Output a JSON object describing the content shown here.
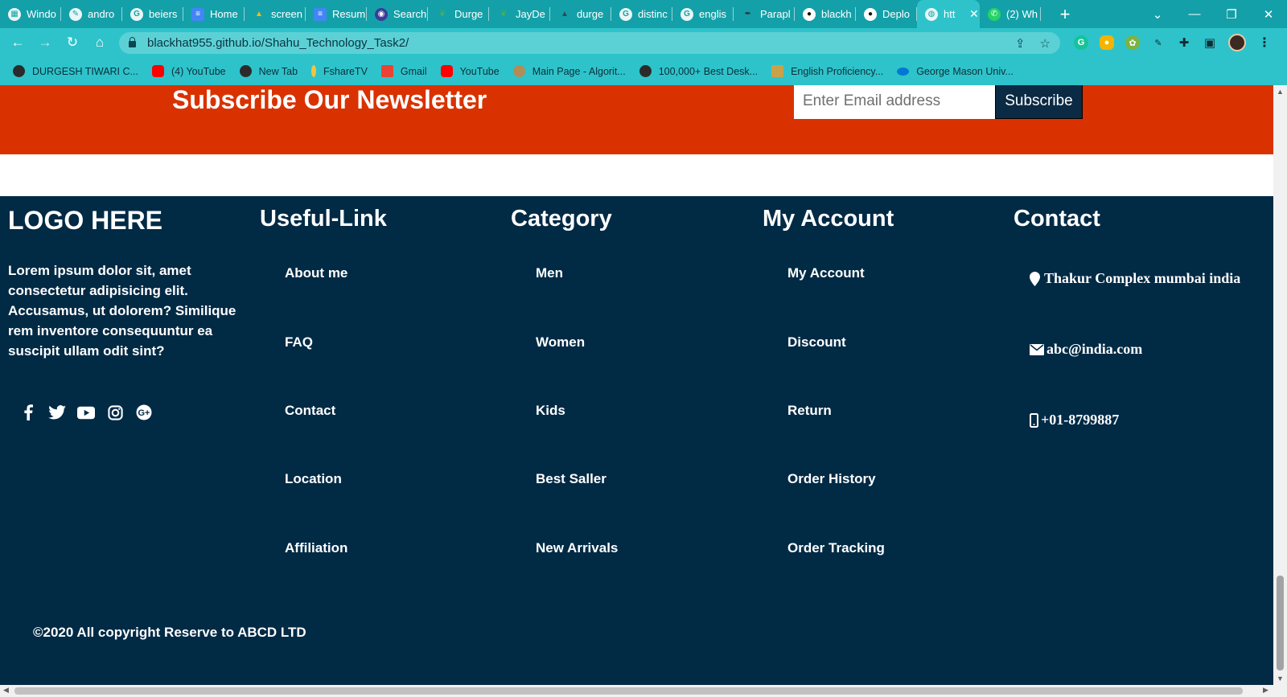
{
  "browser": {
    "tabs": [
      {
        "label": "Windo",
        "icon": "ms-icon",
        "color": "#1e88e5"
      },
      {
        "label": "andro",
        "icon": "android-icon",
        "color": "#a56b2a"
      },
      {
        "label": "beiers",
        "icon": "google-icon",
        "color": "#ffffff"
      },
      {
        "label": "Home",
        "icon": "docs-icon",
        "color": "#4285f4"
      },
      {
        "label": "screen",
        "icon": "drive-icon",
        "color": "#fbbc04"
      },
      {
        "label": "Resum",
        "icon": "docs-icon",
        "color": "#4285f4"
      },
      {
        "label": "Search",
        "icon": "search-engine-icon",
        "color": "#3b3b9b"
      },
      {
        "label": "Durge",
        "icon": "leaf-icon",
        "color": "#4caf50"
      },
      {
        "label": "JayDe",
        "icon": "leaf-icon",
        "color": "#4caf50"
      },
      {
        "label": "durge",
        "icon": "tent-icon",
        "color": "#37474f"
      },
      {
        "label": "distinc",
        "icon": "google-icon",
        "color": "#ffffff"
      },
      {
        "label": "englis",
        "icon": "google-icon",
        "color": "#ffffff"
      },
      {
        "label": "Parapl",
        "icon": "feather-icon",
        "color": "#455a64"
      },
      {
        "label": "blackh",
        "icon": "github-icon",
        "color": "#ffffff"
      },
      {
        "label": "Deplo",
        "icon": "github-icon",
        "color": "#ffffff"
      },
      {
        "label": "htt",
        "icon": "globe-icon",
        "color": "#ffffff",
        "active": true
      },
      {
        "label": "(2) Wh",
        "icon": "whatsapp-icon",
        "color": "#25d366"
      }
    ],
    "new_tab": "+",
    "url": "blackhat955.github.io/Shahu_Technology_Task2/",
    "bookmarks": [
      {
        "label": "DURGESH TIWARI C...",
        "color": "#2b2b2b"
      },
      {
        "label": "(4) YouTube",
        "color": "#ff0000"
      },
      {
        "label": "New Tab",
        "color": "#2b2b2b"
      },
      {
        "label": "FshareTV",
        "color": "#f5c242"
      },
      {
        "label": "Gmail",
        "color": "#ea4335"
      },
      {
        "label": "YouTube",
        "color": "#ff0000"
      },
      {
        "label": "Main Page - Algorit...",
        "color": "#b08d57"
      },
      {
        "label": "100,000+ Best Desk...",
        "color": "#2b2b2b"
      },
      {
        "label": "English Proficiency...",
        "color": "#c8a24b"
      },
      {
        "label": "George Mason Univ...",
        "color": "#0078d4"
      }
    ]
  },
  "newsletter": {
    "title": "Subscribe Our Newsletter",
    "email_placeholder": "Enter Email address",
    "subscribe_label": "Subscribe",
    "bg_color": "#d93200"
  },
  "footer": {
    "logo": "LOGO HERE",
    "about": "Lorem ipsum dolor sit, amet consectetur adipisicing elit. Accusamus, ut dolorem? Similique rem inventore consequuntur ea suscipit ullam odit sint?",
    "social_icons": [
      "facebook-icon",
      "twitter-icon",
      "youtube-icon",
      "instagram-icon",
      "google-plus-icon"
    ],
    "useful_links": {
      "title": "Useful-Link",
      "items": [
        "About me",
        "FAQ",
        "Contact",
        "Location",
        "Affiliation"
      ]
    },
    "category": {
      "title": "Category",
      "items": [
        "Men",
        "Women",
        "Kids",
        "Best Saller",
        "New Arrivals"
      ]
    },
    "my_account": {
      "title": "My Account",
      "items": [
        "My Account",
        "Discount",
        "Return",
        "Order History",
        "Order Tracking"
      ]
    },
    "contact": {
      "title": "Contact",
      "address": "Thakur Complex mumbai india",
      "email": "abc@india.com",
      "phone": "+01-8799887"
    },
    "copyright": "©2020 All copyright Reserve to ABCD LTD",
    "bg_color": "#012a45"
  }
}
